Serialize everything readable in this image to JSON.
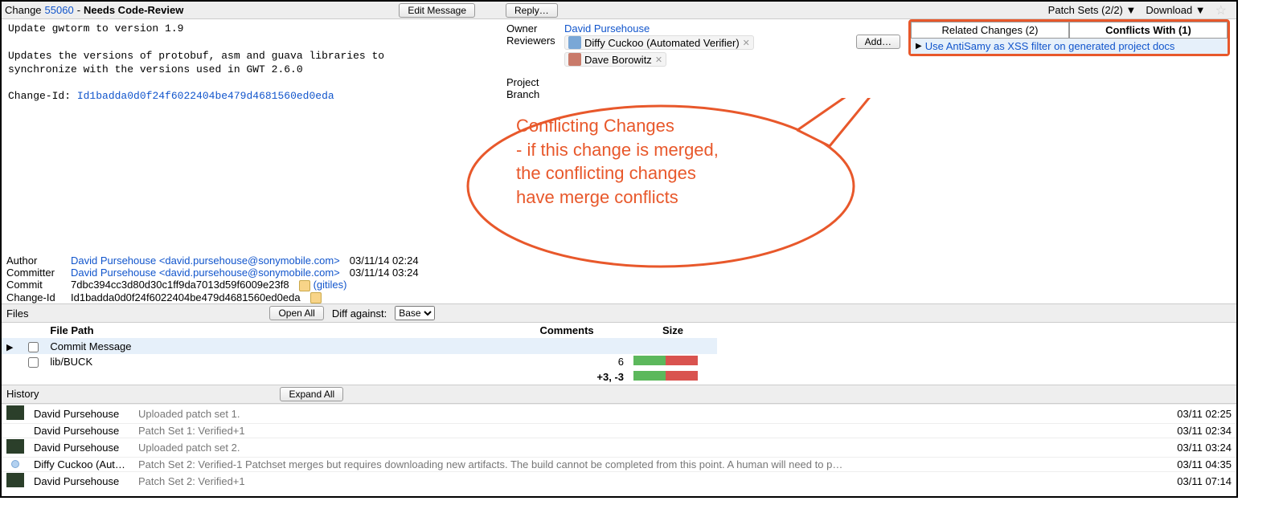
{
  "header": {
    "change_prefix": "Change ",
    "change_number": "55060",
    "status_sep": " - ",
    "status": "Needs Code-Review",
    "edit_btn": "Edit Message",
    "reply_btn": "Reply…",
    "patchsets": "Patch Sets (2/2) ▼",
    "download": "Download ▼"
  },
  "commit_msg": "Update gwtorm to version 1.9\n\nUpdates the versions of protobuf, asm and guava libraries to\nsynchronize with the versions used in GWT 2.6.0\n\nChange-Id: ",
  "commit_msg_changeid": "Id1badda0d0f24f6022404be479d4681560ed0eda",
  "owner": {
    "label": "Owner",
    "name": "David Pursehouse"
  },
  "reviewers": {
    "label": "Reviewers",
    "list": [
      {
        "name": "Diffy Cuckoo (Automated Verifier)"
      },
      {
        "name": "Dave Borowitz"
      }
    ],
    "add_btn": "Add…"
  },
  "project_label": "Project",
  "branch_label": "Branch",
  "related": {
    "tab_related": "Related Changes (2)",
    "tab_conflicts": "Conflicts With (1)",
    "item": "Use AntiSamy as XSS filter on generated project docs"
  },
  "annotation": {
    "l1": "Conflicting Changes",
    "l2": "- if this change is merged,",
    "l3": "  the conflicting changes",
    "l4": "  have merge conflicts"
  },
  "commit_meta": {
    "author_lbl": "Author",
    "author_val": "David Pursehouse <david.pursehouse@sonymobile.com>",
    "author_date": "03/11/14 02:24",
    "committer_lbl": "Committer",
    "committer_val": "David Pursehouse <david.pursehouse@sonymobile.com>",
    "committer_date": "03/11/14 03:24",
    "commit_lbl": "Commit",
    "commit_val": "7dbc394cc3d80d30c1ff9da7013d59f6009e23f8",
    "gitiles": "(gitiles)",
    "changeid_lbl": "Change-Id",
    "changeid_val": "Id1badda0d0f24f6022404be479d4681560ed0eda"
  },
  "files": {
    "section": "Files",
    "open_all": "Open All",
    "diff_against": "Diff against:",
    "diff_base": "Base",
    "col_path": "File Path",
    "col_comments": "Comments",
    "col_size": "Size",
    "rows": [
      {
        "path": "Commit Message",
        "comments": "",
        "size": ""
      },
      {
        "path": "lib/BUCK",
        "comments": "6",
        "size": ""
      }
    ],
    "summary": "+3, -3"
  },
  "history": {
    "section": "History",
    "expand_all": "Expand All",
    "rows": [
      {
        "who": "David Pursehouse",
        "msg": "Uploaded patch set 1.",
        "date": "03/11 02:25",
        "avatar": "user"
      },
      {
        "who": "David Pursehouse",
        "msg": "Patch Set 1: Verified+1",
        "date": "03/11 02:34",
        "avatar": "none"
      },
      {
        "who": "David Pursehouse",
        "msg": "Uploaded patch set 2.",
        "date": "03/11 03:24",
        "avatar": "user"
      },
      {
        "who": "Diffy Cuckoo (Aut…",
        "msg": "Patch Set 2: Verified-1 Patchset merges but requires downloading new artifacts. The build cannot be completed from this point. A human will need to p…",
        "date": "03/11 04:35",
        "avatar": "dot"
      },
      {
        "who": "David Pursehouse",
        "msg": "Patch Set 2: Verified+1",
        "date": "03/11 07:14",
        "avatar": "user"
      }
    ]
  }
}
